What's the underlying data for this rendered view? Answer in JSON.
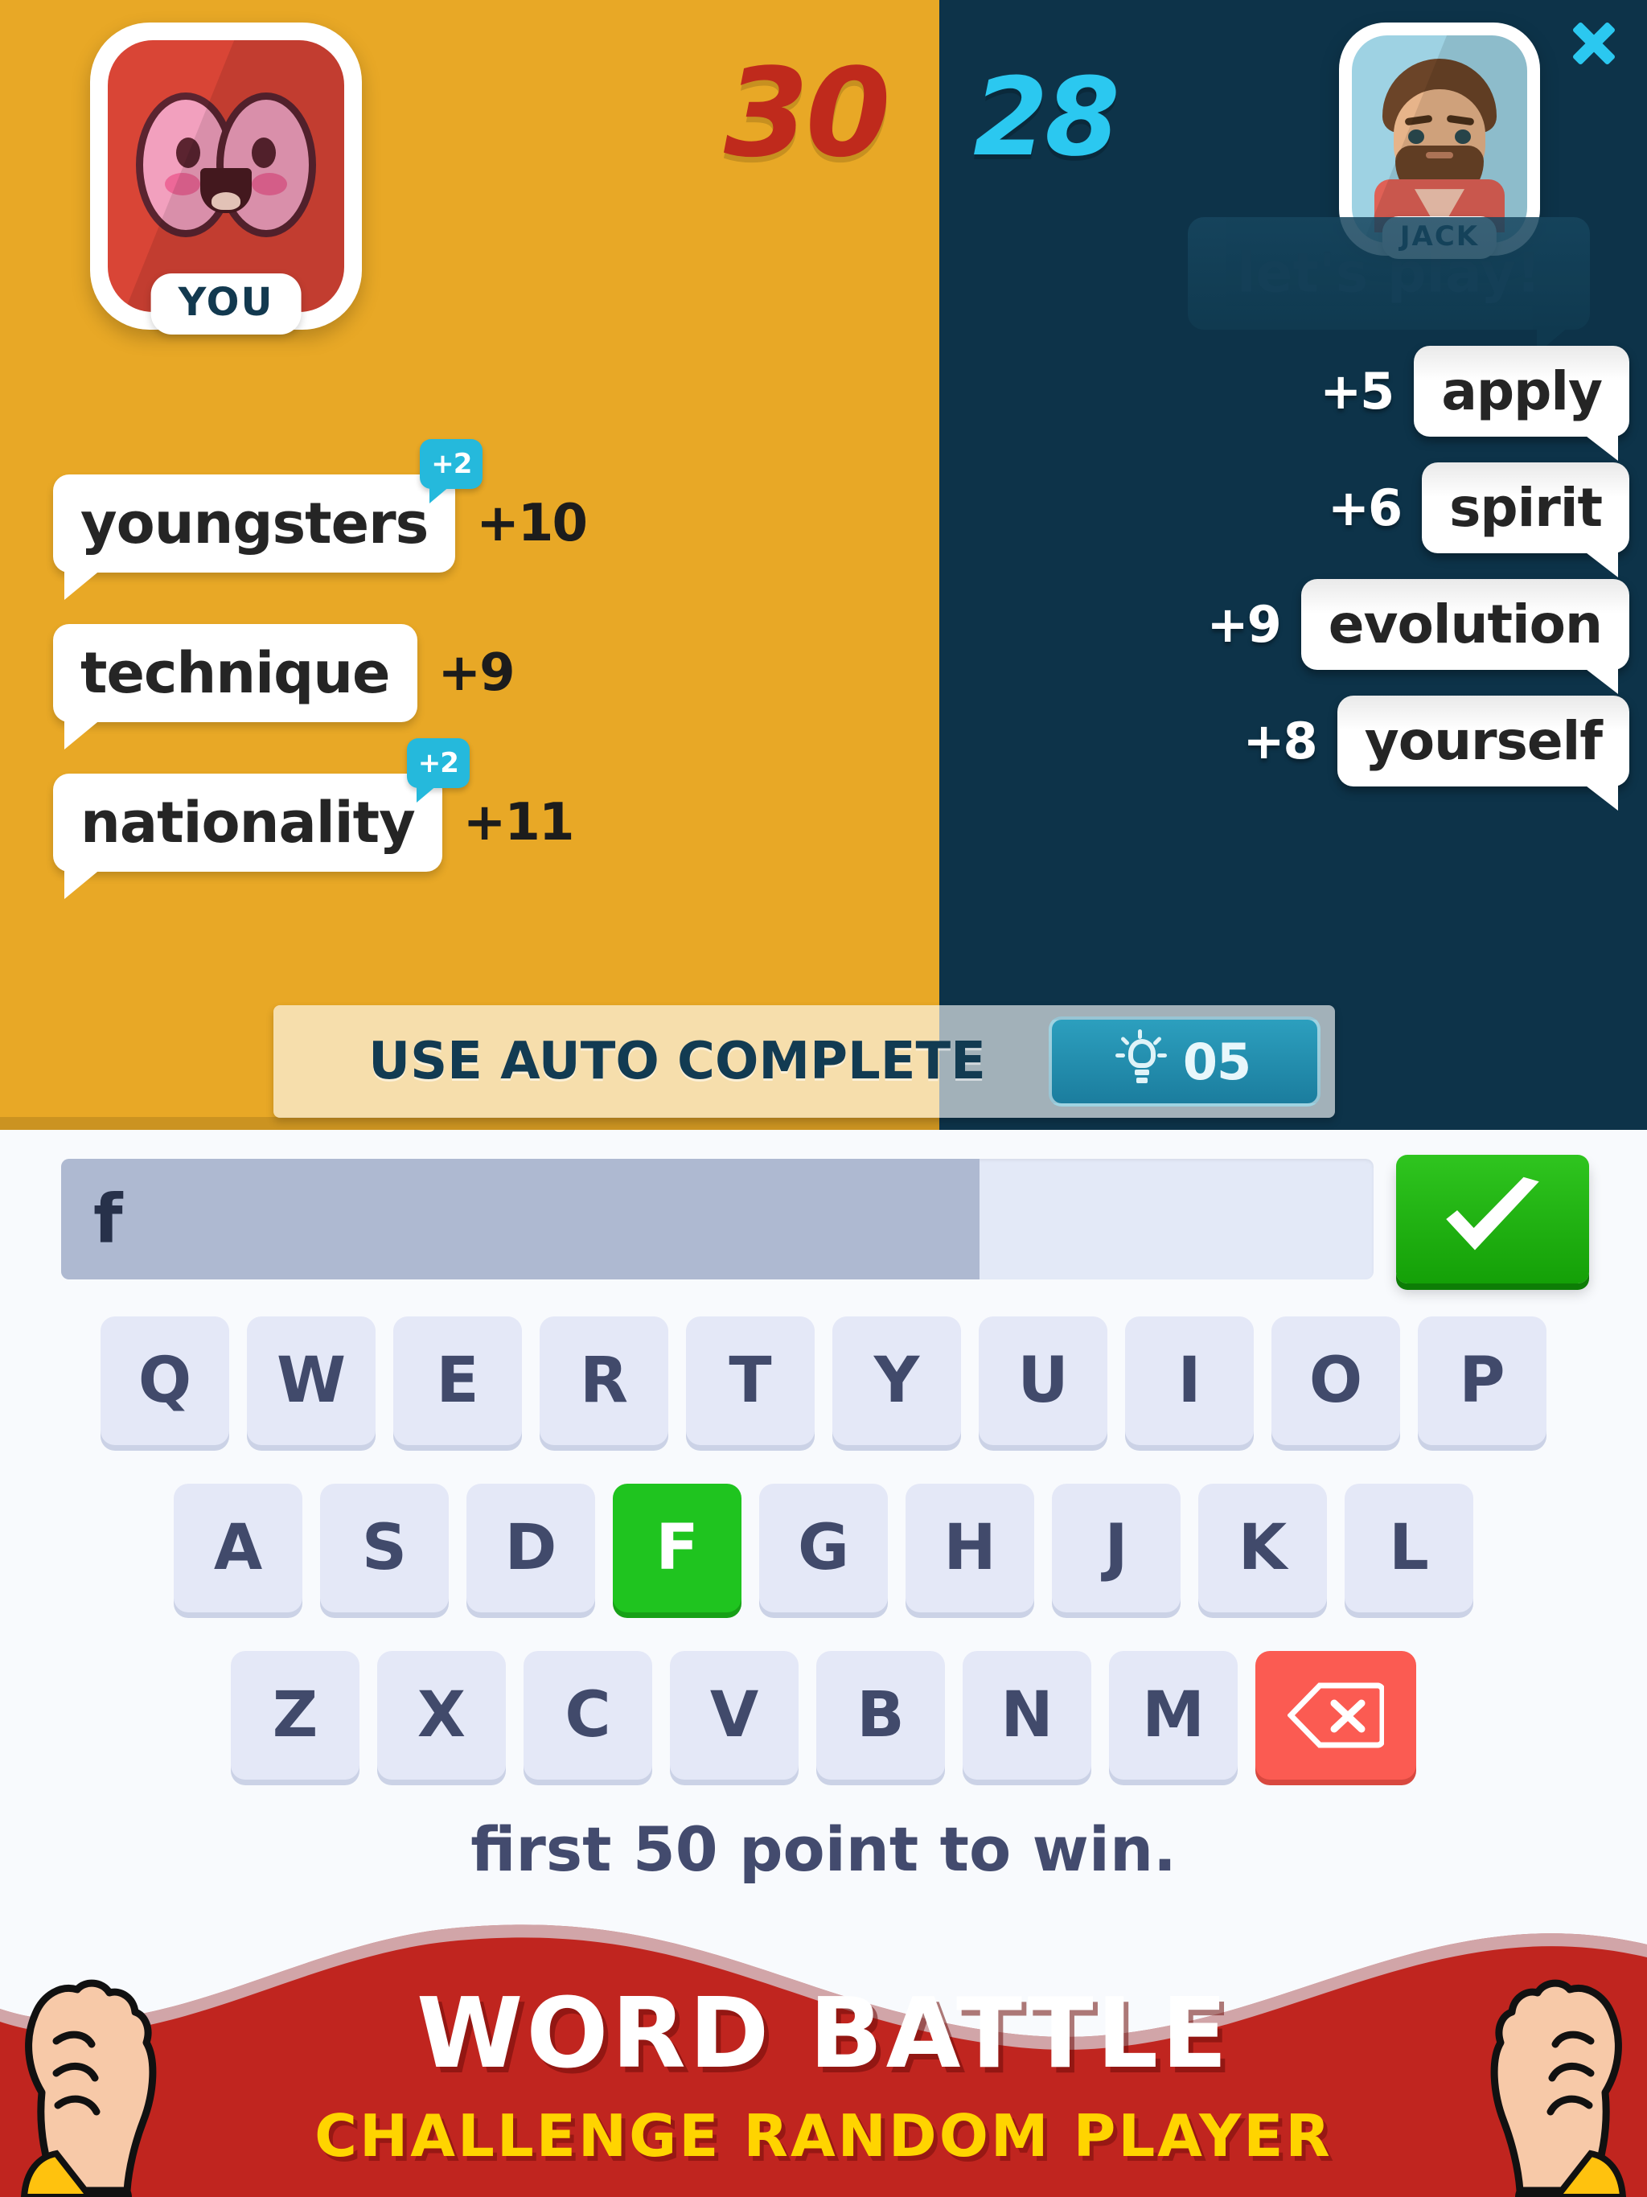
{
  "header": {
    "my_score": "30",
    "opponent_score": "28",
    "my_label": "YOU",
    "opponent_name": "JACK",
    "opponent_greeting": "let's play!",
    "close_icon": "close-icon",
    "my_avatar_icon": "brain-avatar-icon",
    "opponent_avatar_icon": "man-avatar-icon"
  },
  "my_words": [
    {
      "word": "youngsters",
      "points": "+10",
      "bonus": "+2"
    },
    {
      "word": "technique",
      "points": "+9",
      "bonus": ""
    },
    {
      "word": "nationality",
      "points": "+11",
      "bonus": "+2"
    }
  ],
  "opponent_words": [
    {
      "points": "+5",
      "word": "apply",
      "word_prefix": "apply",
      "word_highlight": ""
    },
    {
      "points": "+6",
      "word": "spirit",
      "word_prefix": "spirit",
      "word_highlight": ""
    },
    {
      "points": "+9",
      "word": "evolution",
      "word_prefix": "evolution",
      "word_highlight": ""
    },
    {
      "points": "+8",
      "word": "yourself",
      "word_prefix": "yoursel",
      "word_highlight": "f"
    }
  ],
  "autocomplete": {
    "label": "USE AUTO COMPLETE",
    "count": "05",
    "icon": "lightbulb-icon"
  },
  "input": {
    "value": "f",
    "submit_icon": "checkmark-icon",
    "fill_percent": "70"
  },
  "keyboard": {
    "row1": [
      "Q",
      "W",
      "E",
      "R",
      "T",
      "Y",
      "U",
      "I",
      "O",
      "P"
    ],
    "row2": [
      "A",
      "S",
      "D",
      "F",
      "G",
      "H",
      "J",
      "K",
      "L"
    ],
    "row3": [
      "Z",
      "X",
      "C",
      "V",
      "B",
      "N",
      "M"
    ],
    "active_key": "F",
    "delete_icon": "backspace-icon"
  },
  "tip": "first 50 point to win.",
  "banner": {
    "title": "WORD BATTLE",
    "subtitle": "CHALLENGE RANDOM PLAYER",
    "left_icon": "fist-icon",
    "right_icon": "fist-icon"
  },
  "colors": {
    "panel_left": "#E8A826",
    "panel_right": "#0D3349",
    "my_score": "#BF2A1C",
    "opponent_score": "#2BC8F0",
    "accent_green": "#1FC41F",
    "accent_red": "#FB5B52",
    "banner_red": "#C0251F",
    "banner_yellow": "#FFD400",
    "highlight_letter": "#F41E1E"
  }
}
